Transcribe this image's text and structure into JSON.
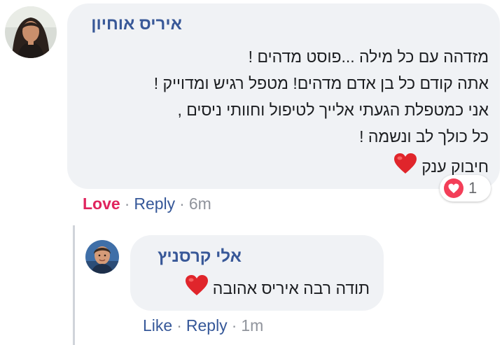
{
  "comment": {
    "author": "איריס אוחיון",
    "lines": [
      "מזדהה עם כל מילה ...פוסט מדהים !",
      "אתה קודם כל בן אדם מדהים! מטפל רגיש ומדוייק !",
      "אני כמטפלת הגעתי אלייך לטיפול וחוותי ניסים ,",
      "כל כולך לב ונשמה !",
      "חיבוק ענק"
    ],
    "reaction": {
      "icon": "heart-reaction-icon",
      "count": "1",
      "color": "#f33e58"
    },
    "actions": {
      "love": "Love",
      "reply": "Reply",
      "separator": "·",
      "time": "6m"
    }
  },
  "reply": {
    "author": "אלי קרסניץ",
    "text": "תודה רבה איריס אהובה",
    "actions": {
      "like": "Like",
      "reply": "Reply",
      "separator": "·",
      "time": "1m"
    }
  },
  "colors": {
    "author": "#385898",
    "bubble": "#f0f2f5",
    "love": "#e0245e",
    "link": "#365899",
    "meta": "#90949c",
    "heart": "#e0252b"
  }
}
